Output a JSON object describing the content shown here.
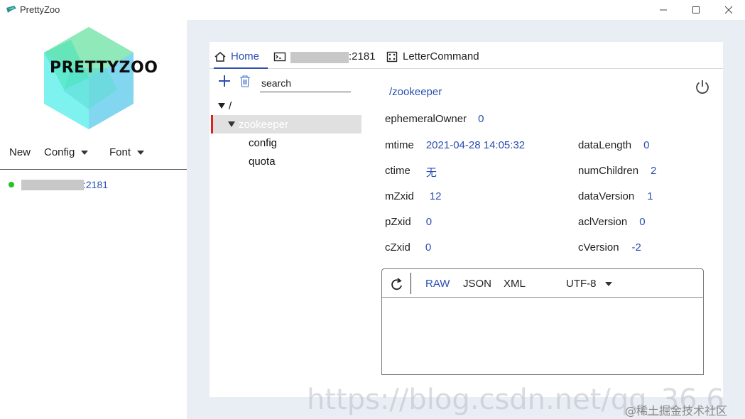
{
  "window": {
    "title": "PrettyZoo",
    "controls": {
      "minimize": "—",
      "maximize": "☐",
      "close": "✕"
    }
  },
  "sidebar": {
    "logo_text": "PRETTYZOO",
    "menu": {
      "new": "New",
      "config": "Config",
      "font": "Font"
    },
    "servers": [
      {
        "port_suffix": ":2181",
        "status_color": "#22c522"
      }
    ]
  },
  "tabs": [
    {
      "label": "Home",
      "icon": "home-icon"
    },
    {
      "label": ":2181",
      "icon": "terminal-icon"
    },
    {
      "label": "LetterCommand",
      "icon": "dice-icon"
    }
  ],
  "tree": {
    "search_placeholder": "search",
    "root": "/",
    "selected": "zookeeper",
    "children": [
      "config",
      "quota"
    ]
  },
  "node": {
    "path": "/zookeeper",
    "ephemeralOwner": {
      "key": "ephemeralOwner",
      "value": "0"
    },
    "mtime": {
      "key": "mtime",
      "value": "2021-04-28 14:05:32"
    },
    "ctime": {
      "key": "ctime",
      "value": "无"
    },
    "mZxid": {
      "key": "mZxid",
      "value": "12"
    },
    "pZxid": {
      "key": "pZxid",
      "value": "0"
    },
    "cZxid": {
      "key": "cZxid",
      "value": "0"
    },
    "dataLength": {
      "key": "dataLength",
      "value": "0"
    },
    "numChildren": {
      "key": "numChildren",
      "value": "2"
    },
    "dataVersion": {
      "key": "dataVersion",
      "value": "1"
    },
    "aclVersion": {
      "key": "aclVersion",
      "value": "0"
    },
    "cVersion": {
      "key": "cVersion",
      "value": "-2"
    }
  },
  "editor": {
    "formats": [
      "RAW",
      "JSON",
      "XML"
    ],
    "active_format": "RAW",
    "encoding": "UTF-8",
    "content": ""
  },
  "watermark": {
    "url": "https://blog.csdn.net/qq_36 6",
    "site": "@稀土掘金技术社区"
  },
  "colors": {
    "accent": "#2b4eb0",
    "selected_marker": "#e0201a",
    "background": "#e9eef4"
  }
}
